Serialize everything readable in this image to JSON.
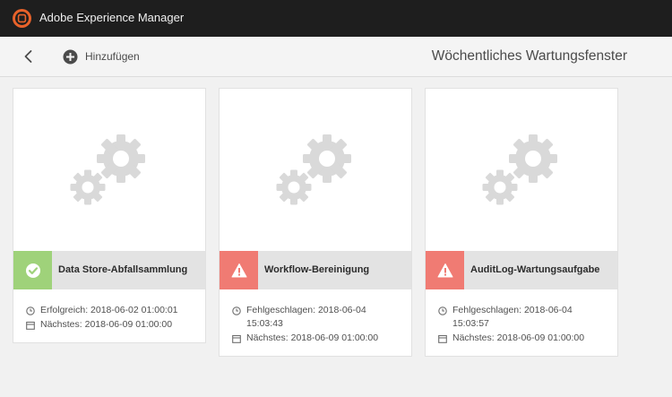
{
  "app": {
    "title": "Adobe Experience Manager",
    "logo_icon": "aem-logo-icon",
    "accent": "#e8622a"
  },
  "actionbar": {
    "back_icon": "chevron-left-icon",
    "add_label": "Hinzufügen",
    "add_icon": "plus-circle-icon",
    "page_title": "Wöchentliches Wartungsfenster"
  },
  "colors": {
    "success": "#9fd27a",
    "error": "#f07b73",
    "status_bar": "#e3e3e3"
  },
  "cards": [
    {
      "name": "Data Store-Abfallsammlung",
      "status": "success",
      "status_icon": "checkmark-circle-icon",
      "last_run": "Erfolgreich: 2018-06-02 01:00:01",
      "next_run": "Nächstes: 2018-06-09 01:00:00"
    },
    {
      "name": "Workflow-Bereinigung",
      "status": "error",
      "status_icon": "alert-triangle-icon",
      "last_run": "Fehlgeschlagen: 2018-06-04 15:03:43",
      "next_run": "Nächstes: 2018-06-09 01:00:00"
    },
    {
      "name": "AuditLog-Wartungsaufgabe",
      "status": "error",
      "status_icon": "alert-triangle-icon",
      "last_run": "Fehlgeschlagen: 2018-06-04 15:03:57",
      "next_run": "Nächstes: 2018-06-09 01:00:00"
    }
  ]
}
